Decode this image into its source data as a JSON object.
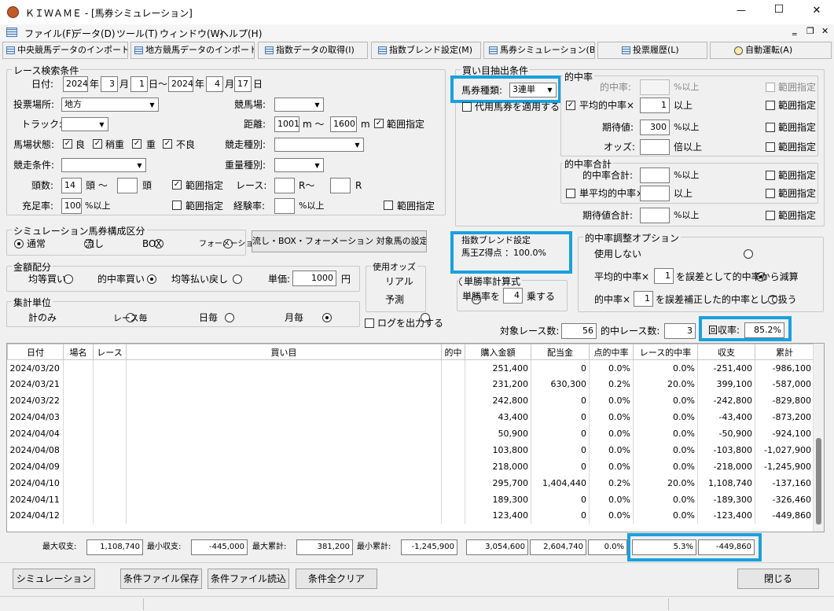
{
  "window": {
    "title": "ＫＩＷＡＭＥ - [馬券シミュレーション]",
    "min": "—",
    "max": "☐",
    "close": "✕"
  },
  "menu": [
    "ファイル(F)",
    "データ(D)",
    "ツール(T)",
    "ウィンドウ(W)",
    "ヘルプ(H)"
  ],
  "mdi": {
    "min": "‗",
    "restore": "❐",
    "close": "✕"
  },
  "toolbar": [
    "中央競馬データのインポート(J)",
    "地方競馬データのインポート(N)",
    "指数データの取得(I)",
    "指数ブレンド設定(M)",
    "馬券シミュレーション(B)",
    "投票履歴(L)",
    "自動運転(A)"
  ],
  "race": {
    "title": "レース検索条件",
    "date_label": "日付:",
    "y1": "2024",
    "m1": "3",
    "d1": "1",
    "y2": "2024",
    "m2": "4",
    "d2": "17",
    "yr": "年",
    "mo": "月",
    "dy": "日～",
    "dy2": "日",
    "venue_label": "投票場所:",
    "venue": "地方",
    "track_label": "競馬場:",
    "surface_label": "トラック:",
    "dist_label": "距離:",
    "dist_min": "1001",
    "dist_max": "1600",
    "m_tilde": "m ～",
    "m": "m",
    "range": "範囲指定",
    "going_label": "馬場状態:",
    "goings": [
      "良",
      "稍重",
      "重",
      "不良"
    ],
    "racetype_label": "競走種別:",
    "cond_label": "競走条件:",
    "weight_label": "重量種別:",
    "runners_label": "頭数:",
    "runners_min": "14",
    "tou_tilde": "頭 ～",
    "tou": "頭",
    "race_label": "レース:",
    "r_tilde": "R～",
    "r": "R",
    "fill_label": "充足率:",
    "fill": "100",
    "pct_above": "%以上",
    "exp_label": "経験率:"
  },
  "sim": {
    "title": "シミュレーション馬券構成区分",
    "opts": [
      "通常",
      "流し",
      "BOX",
      "フォーメーション"
    ],
    "setbtn": "流し・BOX・フォーメーション 対象馬の設定"
  },
  "money": {
    "title": "金額配分",
    "opts": [
      "均等買い",
      "的中率買い",
      "均等払い戻し"
    ],
    "unit_label": "単価:",
    "unit": "1000",
    "yen": "円"
  },
  "odds": {
    "title": "使用オッズ",
    "opts": [
      "リアル",
      "予測"
    ]
  },
  "agg": {
    "title": "集計単位",
    "opts": [
      "計のみ",
      "レース毎",
      "日毎",
      "月毎"
    ],
    "log": "ログを出力する"
  },
  "bet": {
    "title": "買い目抽出条件",
    "type_label": "馬券種類:",
    "type": "3連単",
    "sub": "代用馬券を適用する",
    "hit_title": "的中率",
    "hit_label": "的中率:",
    "avg_hit": "平均的中率×",
    "avg_hit_val": "1",
    "ijou": "以上",
    "exp_label": "期待値:",
    "exp_val": "300",
    "odds_label": "オッズ:",
    "bai_ijou": "倍以上",
    "sum_title": "的中率合計",
    "sum_label": "的中率合計:",
    "single_avg": "単平均的中率×",
    "exp_sum": "期待値合計:"
  },
  "blend": {
    "title": "指数ブレンド設定",
    "text": "馬王Z得点 ：100.0%"
  },
  "winrate": {
    "title": "単勝率計算式",
    "pre": "単勝率を",
    "val": "4",
    "post": "乗する"
  },
  "adj": {
    "title": "的中率調整オプション",
    "o1": "使用しない",
    "o2a": "平均的中率×",
    "o2v": "1",
    "o2b": "を誤差として的中率から減算",
    "o3a": "的中率×",
    "o3v": "1",
    "o3b": "を誤差補正した的中率として扱う"
  },
  "summary": {
    "races_label": "対象レース数:",
    "races": "56",
    "hits_label": "的中レース数:",
    "hits": "3",
    "ret_label": "回収率:",
    "ret": "85.2%"
  },
  "table": {
    "headers": [
      "日付",
      "場名",
      "レース",
      "買い目",
      "的中",
      "購入金額",
      "配当金",
      "点的中率",
      "レース的中率",
      "収支",
      "累計"
    ],
    "rows": [
      [
        "2024/03/20",
        "",
        "",
        "",
        "",
        "251,400",
        "0",
        "0.0%",
        "0.0%",
        "-251,400",
        "-986,100"
      ],
      [
        "2024/03/21",
        "",
        "",
        "",
        "",
        "231,200",
        "630,300",
        "0.2%",
        "20.0%",
        "399,100",
        "-587,000"
      ],
      [
        "2024/03/22",
        "",
        "",
        "",
        "",
        "242,800",
        "0",
        "0.0%",
        "0.0%",
        "-242,800",
        "-829,800"
      ],
      [
        "2024/04/03",
        "",
        "",
        "",
        "",
        "43,400",
        "0",
        "0.0%",
        "0.0%",
        "-43,400",
        "-873,200"
      ],
      [
        "2024/04/04",
        "",
        "",
        "",
        "",
        "50,900",
        "0",
        "0.0%",
        "0.0%",
        "-50,900",
        "-924,100"
      ],
      [
        "2024/04/08",
        "",
        "",
        "",
        "",
        "103,800",
        "0",
        "0.0%",
        "0.0%",
        "-103,800",
        "-1,027,900"
      ],
      [
        "2024/04/09",
        "",
        "",
        "",
        "",
        "218,000",
        "0",
        "0.0%",
        "0.0%",
        "-218,000",
        "-1,245,900"
      ],
      [
        "2024/04/10",
        "",
        "",
        "",
        "",
        "295,700",
        "1,404,440",
        "0.2%",
        "20.0%",
        "1,108,740",
        "-137,160"
      ],
      [
        "2024/04/11",
        "",
        "",
        "",
        "",
        "189,300",
        "0",
        "0.0%",
        "0.0%",
        "-189,300",
        "-326,460"
      ],
      [
        "2024/04/12",
        "",
        "",
        "",
        "",
        "123,400",
        "0",
        "0.0%",
        "0.0%",
        "-123,400",
        "-449,860"
      ]
    ]
  },
  "footer": {
    "max_lbl": "最大収支:",
    "max": "1,108,740",
    "min_lbl": "最小収支:",
    "min": "-445,000",
    "maxc_lbl": "最大累計:",
    "maxc": "381,200",
    "minc_lbl": "最小累計:",
    "minc": "-1,245,900",
    "buy": "3,054,600",
    "pay": "2,604,740",
    "hit": "0.0%",
    "race_hit": "5.3%",
    "balance": "-449,860"
  },
  "buttons": {
    "sim": "シミュレーション",
    "save": "条件ファイル保存",
    "load": "条件ファイル読込",
    "clear": "条件全クリア",
    "close": "閉じる"
  },
  "colors": {
    "highlight": "#1aa0de"
  }
}
